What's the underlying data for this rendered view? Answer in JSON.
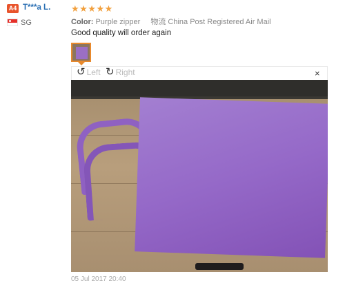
{
  "user": {
    "badge": "A4",
    "name": "T***a L.",
    "country": "SG"
  },
  "review": {
    "stars": "★★★★★",
    "rating": 5,
    "color_label": "Color:",
    "color_value": "Purple zipper",
    "shipping_label": "物流",
    "shipping_value": "China Post Registered Air Mail",
    "text": "Good quality will order again",
    "date": "05 Jul 2017 20:40"
  },
  "viewer": {
    "rotate_left": "Left",
    "rotate_right": "Right",
    "close": "×"
  },
  "colors": {
    "star": "#f2a03d",
    "badge": "#e8542c",
    "username": "#2a6fb3",
    "thumb_border": "#e8892c",
    "bag": "#9569c8"
  }
}
